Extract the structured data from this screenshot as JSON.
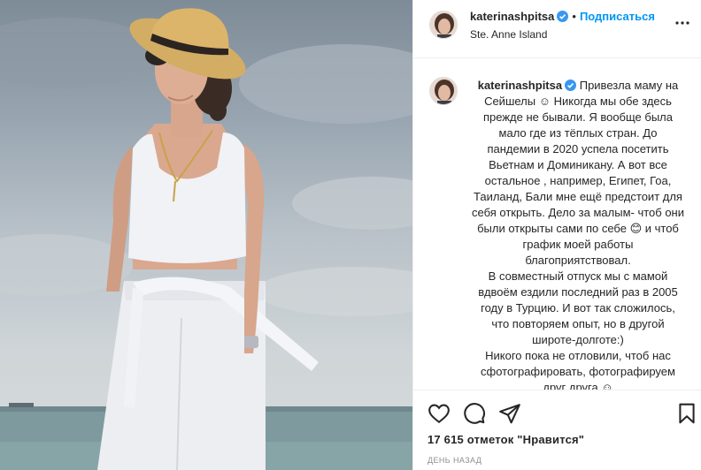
{
  "post": {
    "username": "katerinashpitsa",
    "verified": true,
    "separator": "•",
    "follow_label": "Подписаться",
    "location": "Ste. Anne Island",
    "more_icon": "more-horizontal-icon"
  },
  "caption": {
    "username": "katerinashpitsa",
    "paragraphs": [
      "Привезла маму на Сейшелы ☺ Никогда мы обе здесь прежде не бывали. Я вообще была мало где из тёплых стран. До пандемии в 2020 успела посетить Вьетнам и Доминикану. А вот все остальное , например, Египет, Гоа, Таиланд, Бали мне ещё предстоит для себя открыть. Дело за малым- чтоб они были открыты сами по себе 😊 и чтоб график моей работы благоприятствовал.",
      "В совместный отпуск мы с мамой вдвоём ездили последний раз в 2005 году в Турцию. И вот так сложилось, что повторяем опыт, но в другой широте-долготе:)",
      "Никого пока не отловили, чтоб нас сфотографировать, фотографируем друг друга ☺"
    ]
  },
  "actions": {
    "like_icon": "heart-icon",
    "comment_icon": "comment-icon",
    "share_icon": "share-icon",
    "save_icon": "bookmark-icon"
  },
  "likes_text": "17 615 отметок \"Нравится\"",
  "time_text": "ДЕНЬ НАЗАД",
  "colors": {
    "accent": "#0095f6",
    "text": "#262626",
    "muted": "#8e8e8e",
    "border": "#efefef"
  }
}
